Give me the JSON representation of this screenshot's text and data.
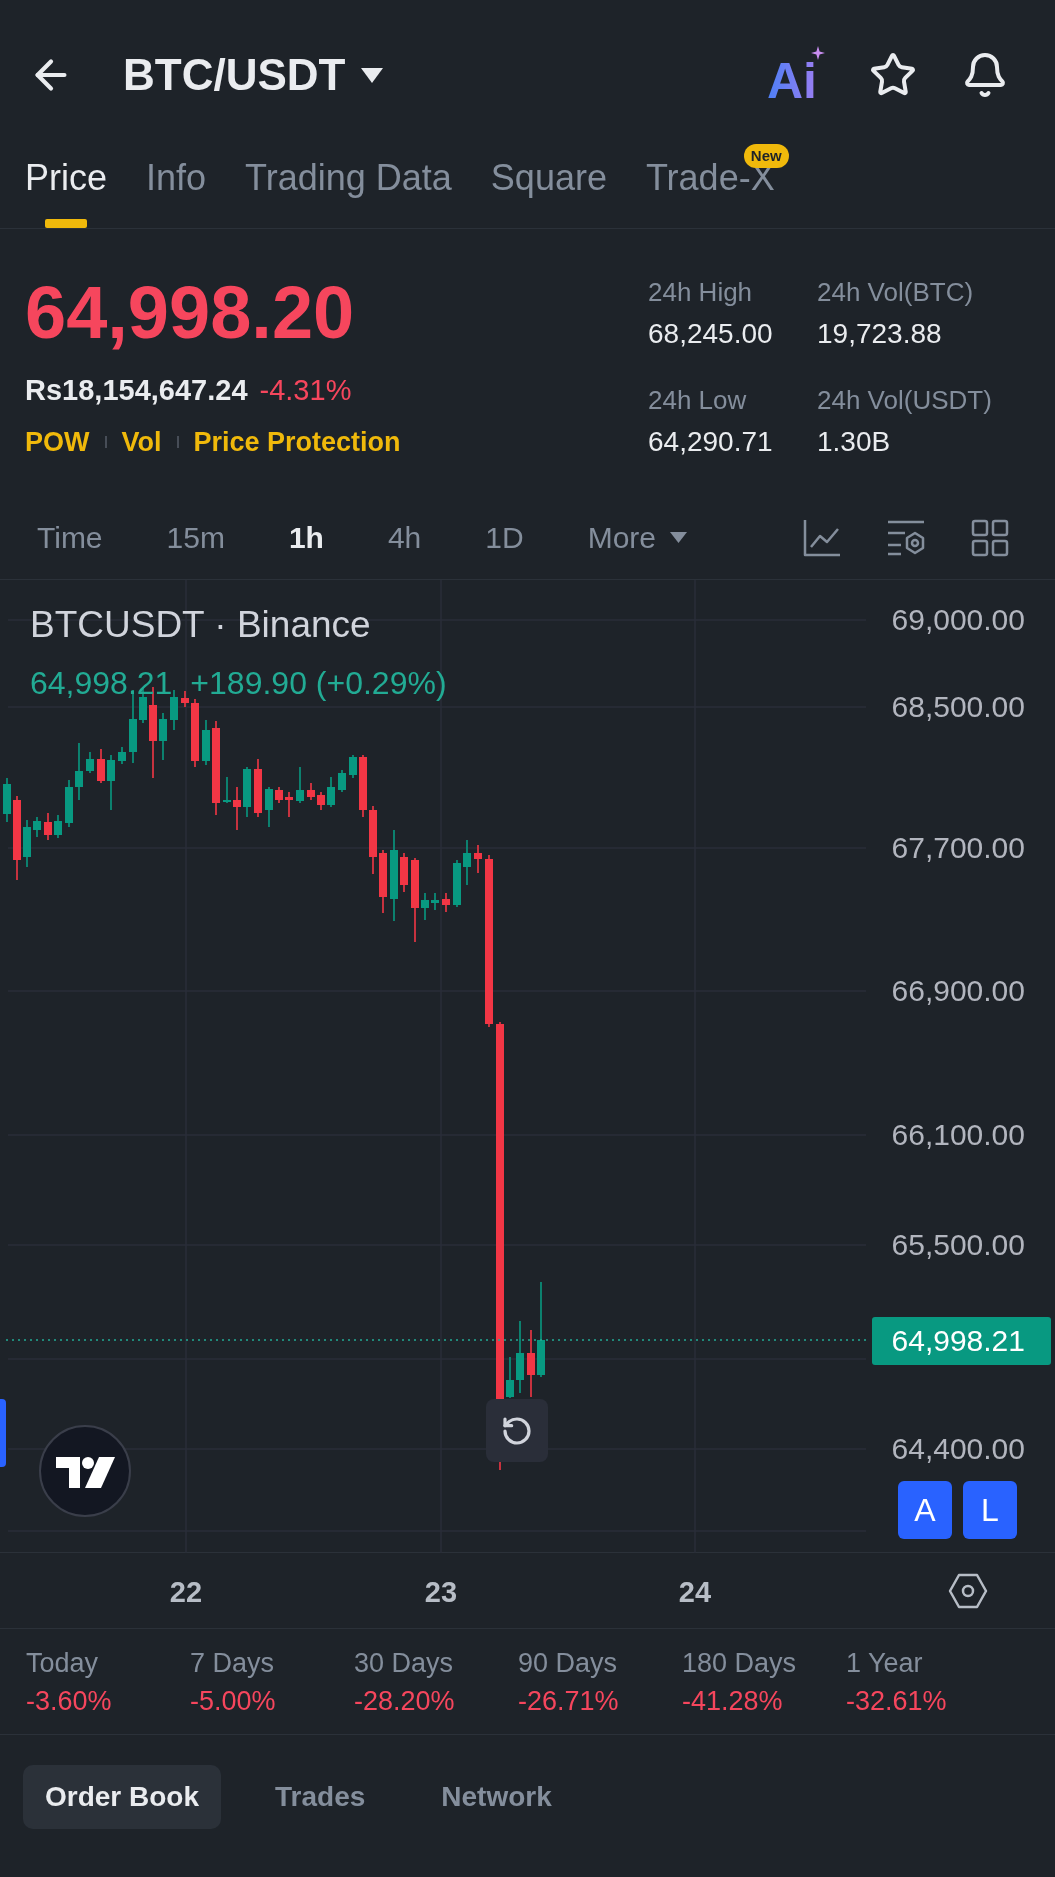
{
  "header": {
    "title": "BTC/USDT",
    "ai_label": "Ai"
  },
  "tabs": [
    {
      "label": "Price",
      "selected": true
    },
    {
      "label": "Info",
      "selected": false
    },
    {
      "label": "Trading Data",
      "selected": false
    },
    {
      "label": "Square",
      "selected": false
    },
    {
      "label": "Trade-X",
      "selected": false,
      "badge": "New"
    }
  ],
  "ticker": {
    "last_price": "64,998.20",
    "down": true,
    "local_price": "Rs18,154,647.24",
    "change": "-4.31%",
    "tags": [
      "POW",
      "Vol",
      "Price Protection"
    ]
  },
  "stats": [
    {
      "label": "24h High",
      "value": "68,245.00"
    },
    {
      "label": "24h Vol(BTC)",
      "value": "19,723.88"
    },
    {
      "label": "24h Low",
      "value": "64,290.71"
    },
    {
      "label": "24h Vol(USDT)",
      "value": "1.30B"
    }
  ],
  "intervals": [
    {
      "label": "Time",
      "selected": false
    },
    {
      "label": "15m",
      "selected": false
    },
    {
      "label": "1h",
      "selected": true
    },
    {
      "label": "4h",
      "selected": false
    },
    {
      "label": "1D",
      "selected": false
    }
  ],
  "more_menu": {
    "label": "More"
  },
  "chart": {
    "symbol": "BTCUSDT · Binance",
    "quote": {
      "last": "64,998.21",
      "change": "+189.90 (+0.29%)",
      "down": false
    },
    "price_axis": [
      "69,000.00",
      "68,500.00",
      "67,700.00",
      "66,900.00",
      "66,100.00",
      "65,500.00",
      "64,400.00"
    ],
    "price_tag": "64,998.21",
    "date_axis": [
      "22",
      "23",
      "24"
    ],
    "scale_buttons": [
      "A",
      "L"
    ]
  },
  "performance": [
    {
      "period": "Today",
      "change": "-3.60%",
      "down": true
    },
    {
      "period": "7 Days",
      "change": "-5.00%",
      "down": true
    },
    {
      "period": "30 Days",
      "change": "-28.20%",
      "down": true
    },
    {
      "period": "90 Days",
      "change": "-26.71%",
      "down": true
    },
    {
      "period": "180 Days",
      "change": "-41.28%",
      "down": true
    },
    {
      "period": "1 Year",
      "change": "-32.61%",
      "down": true
    }
  ],
  "bottom_tabs": [
    {
      "label": "Order Book",
      "selected": true
    },
    {
      "label": "Trades",
      "selected": false
    },
    {
      "label": "Network",
      "selected": false
    }
  ]
}
